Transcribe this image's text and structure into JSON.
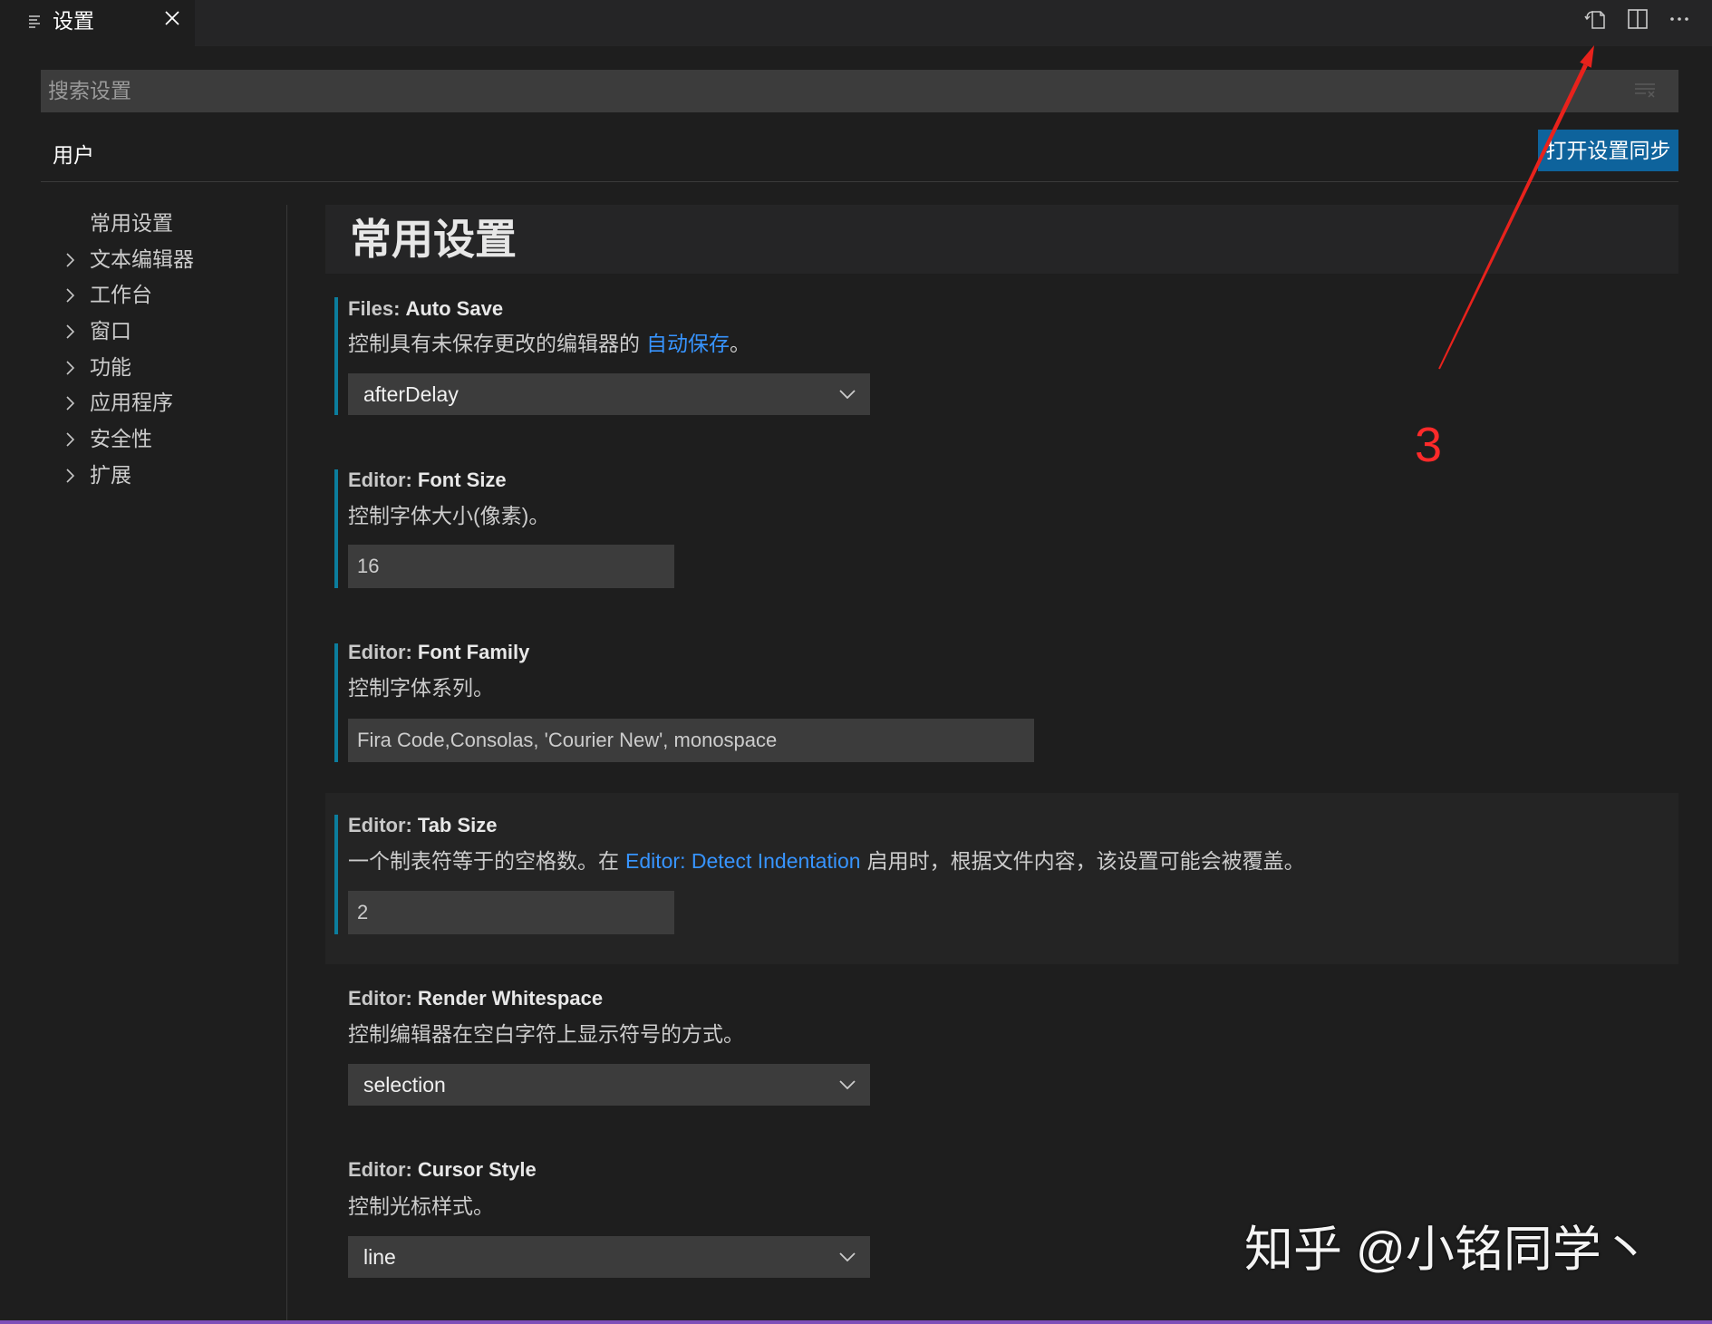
{
  "tab": {
    "title": "设置",
    "icon": "settings-editor-icon",
    "close_icon": "close-icon"
  },
  "toolbar": {
    "icons": [
      "open-settings-json-icon",
      "split-editor-icon",
      "more-actions-icon"
    ]
  },
  "search": {
    "placeholder": "搜索设置",
    "value": "",
    "filter_icon": "clear-filter-icon"
  },
  "scope": {
    "user_label": "用户"
  },
  "sync_button": {
    "label": "打开设置同步"
  },
  "toc": {
    "items": [
      {
        "label": "常用设置",
        "expandable": false
      },
      {
        "label": "文本编辑器",
        "expandable": true
      },
      {
        "label": "工作台",
        "expandable": true
      },
      {
        "label": "窗口",
        "expandable": true
      },
      {
        "label": "功能",
        "expandable": true
      },
      {
        "label": "应用程序",
        "expandable": true
      },
      {
        "label": "安全性",
        "expandable": true
      },
      {
        "label": "扩展",
        "expandable": true
      }
    ]
  },
  "section": {
    "title": "常用设置"
  },
  "settings": [
    {
      "category": "Files:",
      "label": "Auto Save",
      "description": "控制具有未保存更改的编辑器的",
      "link": "自动保存",
      "description_suffix": "。",
      "control": "select",
      "value": "afterDelay",
      "modified": true
    },
    {
      "category": "Editor:",
      "label": "Font Size",
      "description": "控制字体大小(像素)。",
      "control": "number",
      "value": "16",
      "modified": true
    },
    {
      "category": "Editor:",
      "label": "Font Family",
      "description": "控制字体系列。",
      "control": "text",
      "value": "Fira Code,Consolas, 'Courier New', monospace",
      "modified": true
    },
    {
      "category": "Editor:",
      "label": "Tab Size",
      "description": "一个制表符等于的空格数。在",
      "link": "Editor: Detect Indentation",
      "description_suffix": "启用时，根据文件内容，该设置可能会被覆盖。",
      "control": "number",
      "value": "2",
      "modified": true,
      "focused": true
    },
    {
      "category": "Editor:",
      "label": "Render Whitespace",
      "description": "控制编辑器在空白字符上显示符号的方式。",
      "control": "select",
      "value": "selection",
      "modified": false
    },
    {
      "category": "Editor:",
      "label": "Cursor Style",
      "description": "控制光标样式。",
      "control": "select",
      "value": "line",
      "modified": false
    }
  ],
  "annotation": {
    "label": "3",
    "color": "#ff2a2a",
    "shape": "arrow-to-open-settings-json-icon"
  },
  "watermark": {
    "text": "知乎 @小铭同学丶"
  },
  "colors": {
    "modified_indicator": "#0c7d9d",
    "link": "#3794ff",
    "primary_button": "#0e639c",
    "editor_background": "#1e1e1e"
  }
}
